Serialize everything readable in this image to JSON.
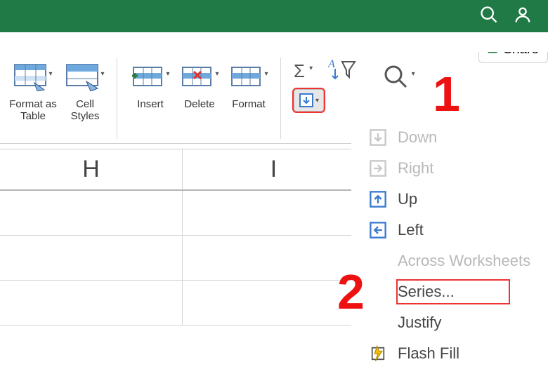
{
  "app": {
    "share_label": "Share"
  },
  "ribbon": {
    "format_as_table": "Format as Table",
    "cell_styles": "Cell Styles",
    "insert": "Insert",
    "delete": "Delete",
    "format": "Format"
  },
  "fill_menu": {
    "down": "Down",
    "right": "Right",
    "up": "Up",
    "left": "Left",
    "across": "Across Worksheets",
    "series": "Series...",
    "justify": "Justify",
    "flash": "Flash Fill"
  },
  "columns": {
    "h": "H",
    "i": "I"
  },
  "callouts": {
    "one": "1",
    "two": "2"
  }
}
